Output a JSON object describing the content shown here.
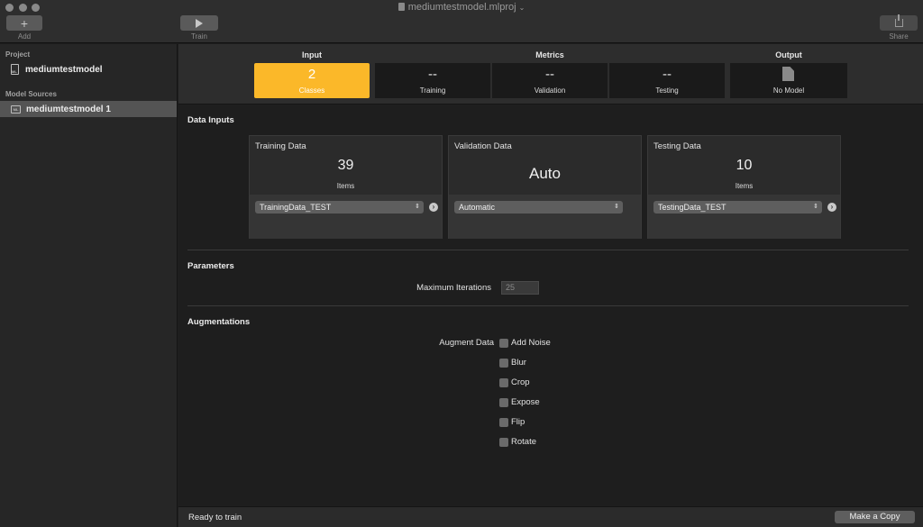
{
  "window": {
    "title": "mediumtestmodel.mlproj"
  },
  "toolbar": {
    "add_label": "Add",
    "train_label": "Train",
    "share_label": "Share"
  },
  "sidebar": {
    "project_header": "Project",
    "project_name": "mediumtestmodel",
    "sources_header": "Model Sources",
    "source_name": "mediumtestmodel 1"
  },
  "tabs": {
    "input": {
      "header": "Input",
      "value": "2",
      "label": "Classes"
    },
    "metrics": {
      "header": "Metrics",
      "training": {
        "value": "--",
        "label": "Training"
      },
      "validation": {
        "value": "--",
        "label": "Validation"
      },
      "testing": {
        "value": "--",
        "label": "Testing"
      }
    },
    "output": {
      "header": "Output",
      "label": "No Model"
    }
  },
  "data_inputs": {
    "heading": "Data Inputs",
    "training": {
      "title": "Training Data",
      "count": "39",
      "unit": "Items",
      "source": "TrainingData_TEST"
    },
    "validation": {
      "title": "Validation Data",
      "count": "Auto",
      "source": "Automatic"
    },
    "testing": {
      "title": "Testing Data",
      "count": "10",
      "unit": "Items",
      "source": "TestingData_TEST"
    }
  },
  "parameters": {
    "heading": "Parameters",
    "max_iterations_label": "Maximum Iterations",
    "max_iterations_value": "25"
  },
  "augmentations": {
    "heading": "Augmentations",
    "label": "Augment Data",
    "options": [
      "Add Noise",
      "Blur",
      "Crop",
      "Expose",
      "Flip",
      "Rotate"
    ]
  },
  "status": {
    "text": "Ready to train",
    "copy_button": "Make a Copy"
  },
  "colors": {
    "accent": "#fbb829",
    "background": "#1e1e1e",
    "panel": "#2d2d2d"
  }
}
